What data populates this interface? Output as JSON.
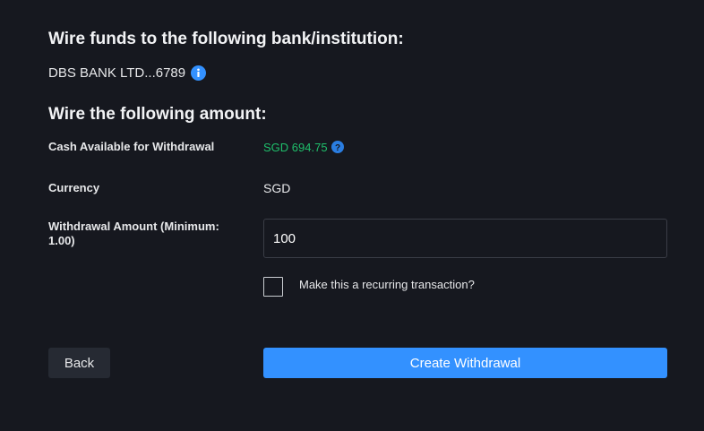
{
  "wire_destination": {
    "heading": "Wire funds to the following bank/institution:",
    "bank_name": "DBS BANK LTD...6789",
    "info_icon": "info-icon"
  },
  "wire_amount": {
    "heading": "Wire the following amount:",
    "cash_available": {
      "label": "Cash Available for Withdrawal",
      "value": "SGD 694.75",
      "value_color": "#1fbf6b",
      "help_icon": "question-circle-icon"
    },
    "currency": {
      "label": "Currency",
      "value": "SGD"
    },
    "withdrawal_amount": {
      "label": "Withdrawal Amount (Minimum: 1.00)",
      "value": "100"
    },
    "recurring": {
      "label": "Make this a recurring transaction?",
      "checked": false
    }
  },
  "actions": {
    "back_label": "Back",
    "create_label": "Create Withdrawal",
    "primary_color": "#3391ff"
  }
}
